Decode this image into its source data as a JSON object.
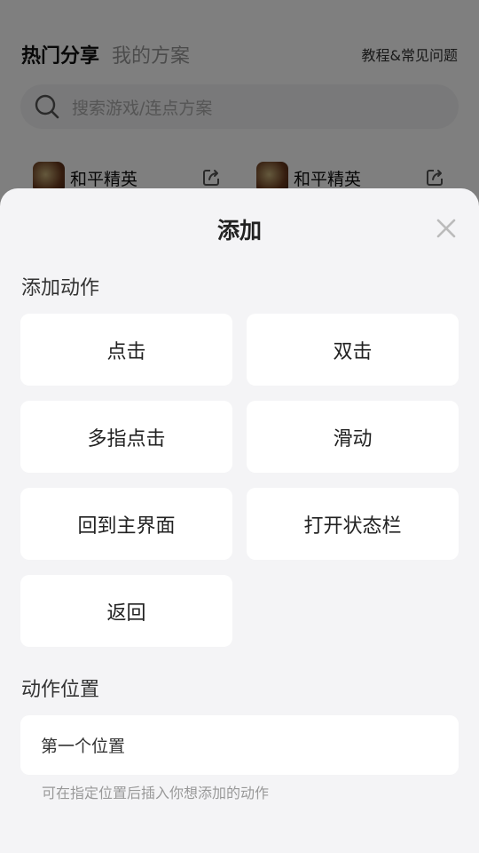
{
  "background": {
    "tabs": {
      "hot_share": "热门分享",
      "my_plans": "我的方案"
    },
    "help_link": "教程&常见问题",
    "search": {
      "placeholder": "搜索游戏/连点方案"
    },
    "games": [
      {
        "name": "和平精英"
      },
      {
        "name": "和平精英"
      }
    ]
  },
  "sheet": {
    "title": "添加",
    "actions_label": "添加动作",
    "actions": [
      {
        "label": "点击"
      },
      {
        "label": "双击"
      },
      {
        "label": "多指点击"
      },
      {
        "label": "滑动"
      },
      {
        "label": "回到主界面"
      },
      {
        "label": "打开状态栏"
      },
      {
        "label": "返回"
      }
    ],
    "position_label": "动作位置",
    "position_value": "第一个位置",
    "position_hint": "可在指定位置后插入你想添加的动作"
  },
  "icons": {
    "search": "search-icon",
    "share": "share-icon",
    "close": "close-icon"
  },
  "colors": {
    "sheet_bg": "#f4f4f6",
    "overlay": "rgba(0,0,0,0.5)"
  }
}
